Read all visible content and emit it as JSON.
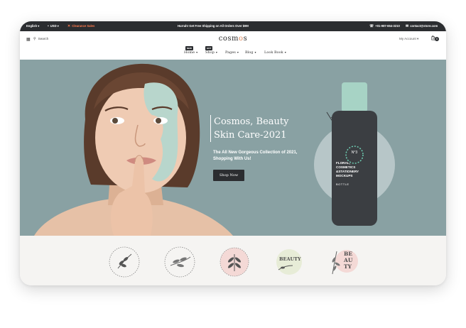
{
  "topbar": {
    "language": "English",
    "currency": "USD",
    "clearance": "Clearance Sales",
    "promo": "Hurrah! Get Free Shipping on All Orders Over $99!",
    "phone": "+01-987-654-3210",
    "email": "contact@store.com"
  },
  "header": {
    "search_label": "Search",
    "logo_prefix": "cosm",
    "logo_accent": "o",
    "logo_suffix": "s",
    "account_label": "My Account",
    "cart_count": "0"
  },
  "nav": {
    "items": [
      {
        "label": "Home",
        "badge": "NEW"
      },
      {
        "label": "Shop",
        "badge": "HOT"
      },
      {
        "label": "Pages",
        "badge": ""
      },
      {
        "label": "Blog",
        "badge": ""
      },
      {
        "label": "Look Book",
        "badge": ""
      }
    ]
  },
  "hero": {
    "title_line1": "Cosmos, Beauty",
    "title_line2": "Skin Care-2021",
    "subtitle": "The All New Gorgeous Collection of 2021, Shopping With Us!",
    "button_label": "Shop Now",
    "bottle_label": {
      "number": "N°3",
      "line1": "FLORAL,",
      "line2": "COSMETICS",
      "line3": "&STATIONERY",
      "line4": "MOCKUPS",
      "line5": "BOTTLE"
    }
  },
  "brands": {
    "logo3_text": "BEAUTY",
    "logo4_text": "BEAUTY"
  },
  "colors": {
    "hero_bg": "#89a1a3",
    "topbar_bg": "#2b2d30",
    "accent": "#e0895b",
    "clearance": "#ff7a4d"
  }
}
